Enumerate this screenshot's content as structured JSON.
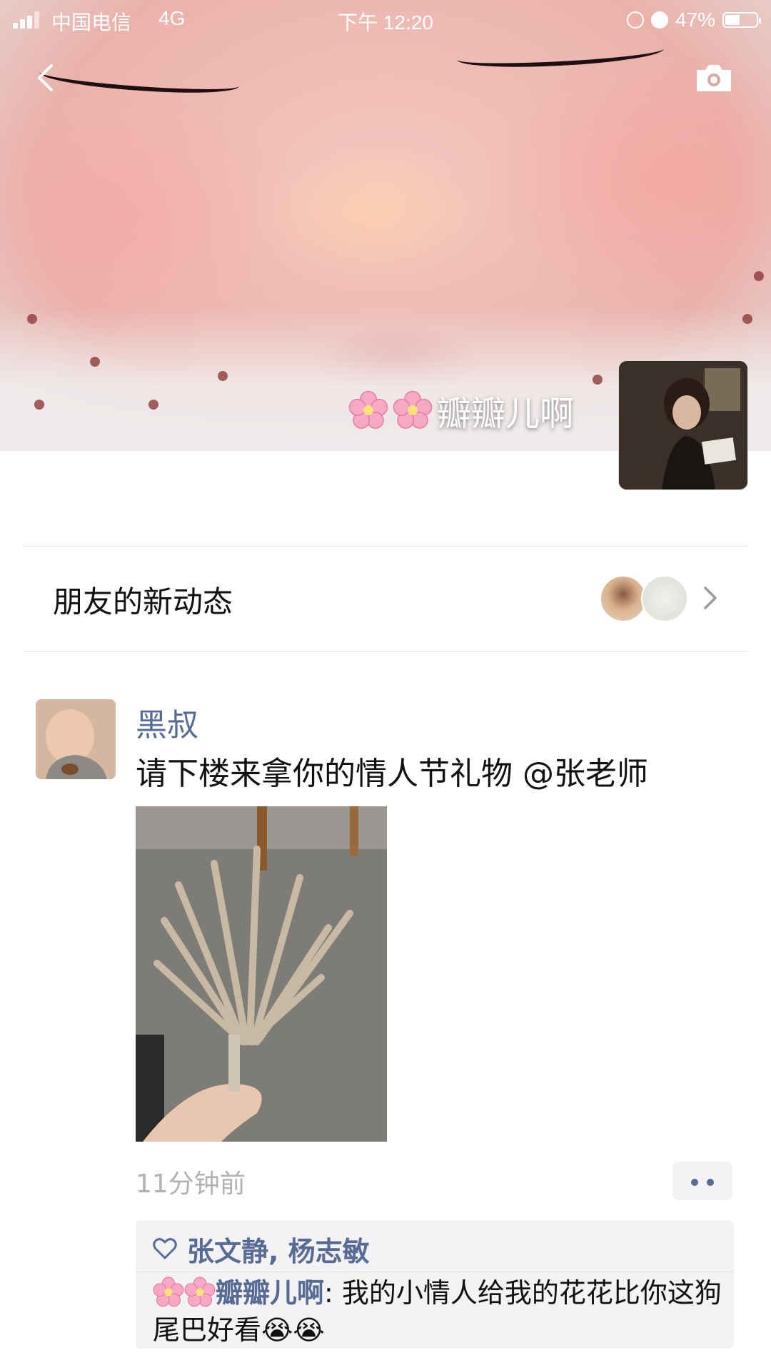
{
  "status_bar": {
    "carrier": "中国电信",
    "network": "4G",
    "time": "下午 12:20",
    "battery_text": "47%",
    "battery_level": 0.47
  },
  "profile": {
    "name": "瓣瓣儿啊"
  },
  "friends_updates": {
    "label": "朋友的新动态"
  },
  "post": {
    "author": "黑叔",
    "text": "请下楼来拿你的情人节礼物 @张老师",
    "time": "11分钟前",
    "likes": "张文静, 杨志敏",
    "comment": {
      "author": "瓣瓣儿啊",
      "separator": ": ",
      "text": "我的小情人给我的花花比你这狗尾巴好看",
      "emojis": "😭😭"
    }
  },
  "icons": {
    "back": "chevron-left-icon",
    "camera": "camera-icon",
    "chevron": "chevron-right-icon",
    "heart": "heart-outline-icon",
    "more": "more-dots-icon"
  },
  "colors": {
    "link_blue": "#576b95",
    "time_gray": "#b2b2b2",
    "comment_bg": "#f3f3f5"
  }
}
